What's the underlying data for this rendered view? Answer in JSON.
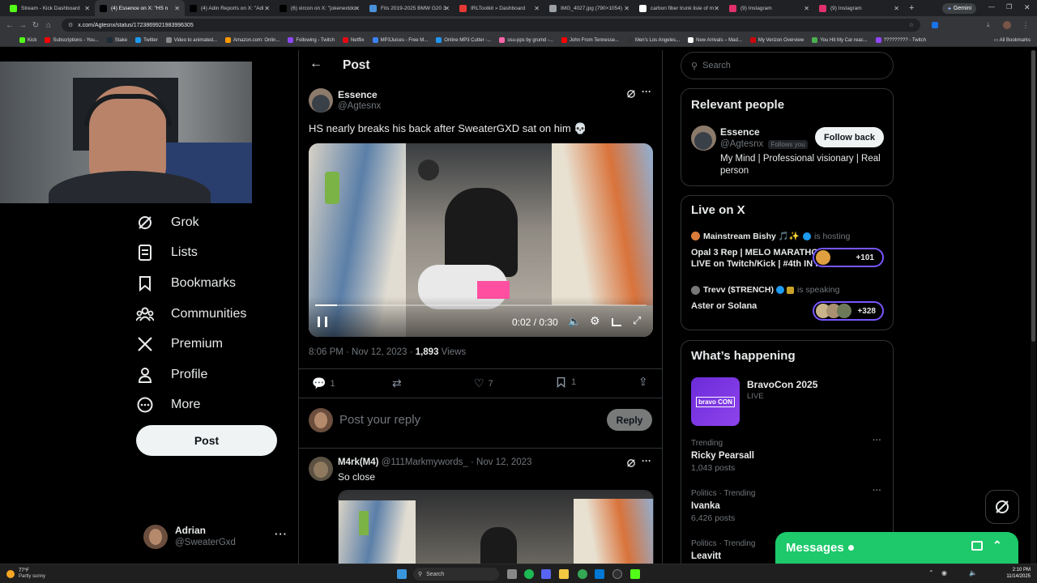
{
  "browser": {
    "tabs": [
      {
        "label": "Stream - Kick Dashboard",
        "color": "#53fc18",
        "active": false
      },
      {
        "label": "(4) Essence on X: \"HS n",
        "color": "#000000",
        "active": true
      },
      {
        "label": "(4) Adin Reports on X: \"Adi",
        "color": "#000000",
        "active": false
      },
      {
        "label": "(6) xircon on X: \"jokenextdo",
        "color": "#000000",
        "active": false
      },
      {
        "label": "Fits 2019-2025 BMW G20 3",
        "color": "#4a90d9",
        "active": false
      },
      {
        "label": "IRLToolkit » Dashboard",
        "color": "#e53935",
        "active": false
      },
      {
        "label": "IMG_4027.jpg (790×1054)",
        "color": "#9aa0a6",
        "active": false
      },
      {
        "label": "carbon fiber trunk lisle of m",
        "color": "#ffffff",
        "active": false
      },
      {
        "label": "(9) Instagram",
        "color": "#e1306c",
        "active": false
      },
      {
        "label": "(9) Instagram",
        "color": "#e1306c",
        "active": false
      }
    ],
    "gemini_label": "Gemini",
    "url": "x.com/Agtesnx/status/1723869921983996305",
    "bookmarks": [
      {
        "label": "Kick",
        "color": "#53fc18"
      },
      {
        "label": "Subscriptions - You...",
        "color": "#ff0000"
      },
      {
        "label": "Stake",
        "color": "#1a2c38"
      },
      {
        "label": "Twitter",
        "color": "#1d9bf0"
      },
      {
        "label": "Video to animated...",
        "color": "#888888"
      },
      {
        "label": "Amazon.com: Onlin...",
        "color": "#ff9900"
      },
      {
        "label": "Following - Twitch",
        "color": "#9146ff"
      },
      {
        "label": "Netflix",
        "color": "#e50914"
      },
      {
        "label": "MP3Juices - Free M...",
        "color": "#3b82f6"
      },
      {
        "label": "Online MP3 Cutter -...",
        "color": "#2196f3"
      },
      {
        "label": "osu-pps by grumd -...",
        "color": "#ff66aa"
      },
      {
        "label": "John From Tennesse...",
        "color": "#ff0000"
      },
      {
        "label": "Men's Los Angeles...",
        "color": "#333333"
      },
      {
        "label": "New Arrivals – Mad...",
        "color": "#ffffff"
      },
      {
        "label": "My Verizon Overview",
        "color": "#cd040b"
      },
      {
        "label": "You Hit My Car reac...",
        "color": "#4caf50"
      },
      {
        "label": "????????? - Twitch",
        "color": "#9146ff"
      }
    ],
    "all_bookmarks": "All Bookmarks"
  },
  "nav": {
    "items": [
      {
        "label": "Grok",
        "icon": "grok-icon"
      },
      {
        "label": "Lists",
        "icon": "lists-icon"
      },
      {
        "label": "Bookmarks",
        "icon": "bookmark-icon"
      },
      {
        "label": "Communities",
        "icon": "communities-icon"
      },
      {
        "label": "Premium",
        "icon": "x-logo-icon"
      },
      {
        "label": "Profile",
        "icon": "profile-icon"
      },
      {
        "label": "More",
        "icon": "more-circle-icon"
      }
    ],
    "post_button": "Post",
    "account": {
      "name": "Adrian",
      "handle": "@SweaterGxd"
    }
  },
  "post_page": {
    "header": "Post",
    "author": {
      "name": "Essence",
      "handle": "@Agtesnx"
    },
    "text": "HS nearly breaks his back after SweaterGXD sat on him 💀",
    "video": {
      "time": "0:02 / 0:30",
      "progress": 0.067
    },
    "meta": {
      "time": "8:06 PM · Nov 12, 2023 · ",
      "views_count": "1,893",
      "views_label": " Views"
    },
    "stats": {
      "replies": "1",
      "reposts": "",
      "likes": "7",
      "bookmarks": "1"
    },
    "reply_placeholder": "Post your reply",
    "reply_button": "Reply",
    "reply": {
      "name": "M4rk(M4)",
      "handle": "@111Markmywords_",
      "date": "· Nov 12, 2023",
      "text": "So close"
    }
  },
  "sidebar": {
    "search_placeholder": "Search",
    "relevant": {
      "title": "Relevant people",
      "name": "Essence",
      "handle": "@Agtesnx",
      "follows_you": "Follows you",
      "follow_button": "Follow back",
      "bio": "My Mind | Professional visionary | Real person"
    },
    "live": {
      "title": "Live on X",
      "items": [
        {
          "host": "Mainstream Bishy 🎵✨",
          "action": "is hosting",
          "title": "Opal 3 Rep | MELO MARATHON LIVE on Twitch/Kick | #4th IN ...",
          "count": "+101"
        },
        {
          "host": "Trevv ($TRENCH)",
          "action": "is speaking",
          "title": "Aster or Solana",
          "count": "+328"
        }
      ]
    },
    "happening": {
      "title": "What’s happening",
      "event": {
        "name": "BravoCon 2025",
        "status": "LIVE",
        "logo": "bravo CON"
      },
      "trends": [
        {
          "context": "Trending",
          "name": "Ricky Pearsall",
          "posts": "1,043 posts"
        },
        {
          "context": "Politics · Trending",
          "name": "Ivanka",
          "posts": "6,426 posts"
        },
        {
          "context": "Politics · Trending",
          "name": "Leavitt",
          "posts": ""
        }
      ]
    }
  },
  "messages": {
    "label": "Messages"
  },
  "taskbar": {
    "weather_temp": "77°F",
    "weather_desc": "Partly sunny",
    "search": "Search",
    "time": "2:10 PM",
    "date": "11/14/2025"
  },
  "colors": {
    "accent": "#1d9bf0",
    "messages": "#1dc96a",
    "live_border": "#7856ff"
  }
}
